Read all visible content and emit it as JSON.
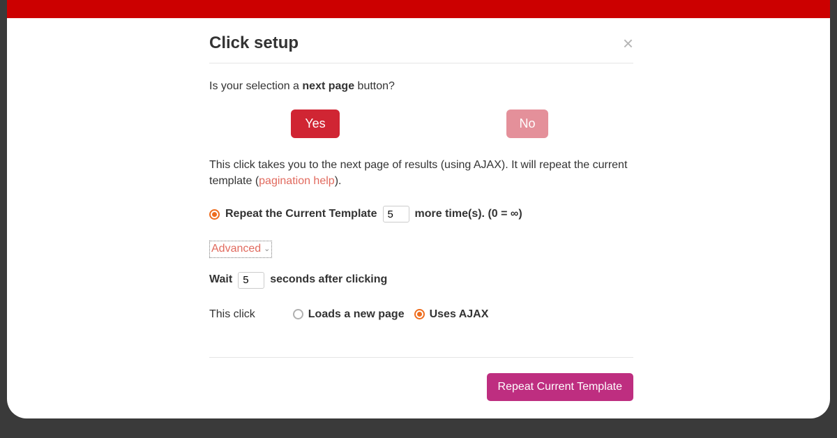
{
  "header": {
    "title": "Click setup"
  },
  "question": {
    "prefix": "Is your selection a ",
    "bold": "next page",
    "suffix": " button?"
  },
  "buttons": {
    "yes": "Yes",
    "no": "No"
  },
  "description": {
    "text_before": "This click takes you to the next page of results (using AJAX). It will repeat the current template (",
    "link": "pagination help",
    "text_after": ")."
  },
  "repeat": {
    "label_before": "Repeat the Current Template",
    "value": "5",
    "label_after": "more time(s). (0 = ∞)"
  },
  "advanced_label": "Advanced",
  "wait": {
    "label_before": "Wait",
    "value": "5",
    "label_after": "seconds after clicking"
  },
  "load_type": {
    "label": "This click",
    "opt_new_page": "Loads a new page",
    "opt_ajax": "Uses AJAX"
  },
  "footer": {
    "primary": "Repeat Current Template"
  }
}
